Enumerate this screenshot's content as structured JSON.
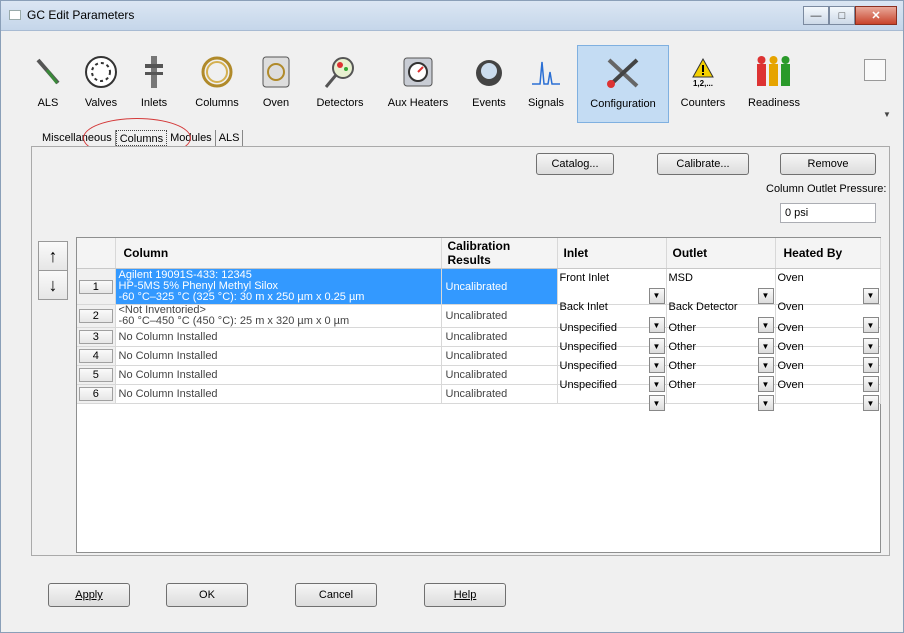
{
  "window": {
    "title": "GC Edit Parameters"
  },
  "toolbar": [
    {
      "label": "ALS",
      "icon": "syringe-icon"
    },
    {
      "label": "Valves",
      "icon": "valve-icon"
    },
    {
      "label": "Inlets",
      "icon": "inlet-icon"
    },
    {
      "label": "Columns",
      "icon": "column-icon"
    },
    {
      "label": "Oven",
      "icon": "oven-icon"
    },
    {
      "label": "Detectors",
      "icon": "detector-icon"
    },
    {
      "label": "Aux Heaters",
      "icon": "aux-heater-icon"
    },
    {
      "label": "Events",
      "icon": "events-icon"
    },
    {
      "label": "Signals",
      "icon": "signal-icon"
    },
    {
      "label": "Configuration",
      "icon": "configuration-icon",
      "active": true
    },
    {
      "label": "Counters",
      "icon": "counters-icon",
      "sublabel": "1,2,..."
    },
    {
      "label": "Readiness",
      "icon": "readiness-icon"
    }
  ],
  "subtabs": [
    "Miscellaneous",
    "Columns",
    "Modules",
    "ALS"
  ],
  "actions": {
    "catalog": "Catalog...",
    "calibrate": "Calibrate...",
    "remove": "Remove"
  },
  "outlet_pressure": {
    "label": "Column Outlet Pressure:",
    "value": "0 psi"
  },
  "grid": {
    "headers": [
      "Column",
      "Calibration Results",
      "Inlet",
      "Outlet",
      "Heated By"
    ],
    "rows": [
      {
        "num": "1",
        "column": [
          "Agilent 19091S-433: 12345",
          "HP-5MS  5% Phenyl Methyl Silox",
          "-60 °C–325 °C (325 °C): 30 m x 250 µm x 0.25 µm"
        ],
        "cal": "Uncalibrated",
        "inlet": "Front Inlet",
        "outlet": "MSD",
        "heated": "Oven"
      },
      {
        "num": "2",
        "column": [
          "<Not Inventoried>",
          "-60 °C–450 °C (450 °C): 25 m x 320 µm x 0 µm"
        ],
        "cal": "Uncalibrated",
        "inlet": "Back Inlet",
        "outlet": "Back Detector",
        "heated": "Oven"
      },
      {
        "num": "3",
        "column": [
          "No Column Installed"
        ],
        "cal": "Uncalibrated",
        "inlet": "Unspecified",
        "outlet": "Other",
        "heated": "Oven"
      },
      {
        "num": "4",
        "column": [
          "No Column Installed"
        ],
        "cal": "Uncalibrated",
        "inlet": "Unspecified",
        "outlet": "Other",
        "heated": "Oven"
      },
      {
        "num": "5",
        "column": [
          "No Column Installed"
        ],
        "cal": "Uncalibrated",
        "inlet": "Unspecified",
        "outlet": "Other",
        "heated": "Oven"
      },
      {
        "num": "6",
        "column": [
          "No Column Installed"
        ],
        "cal": "Uncalibrated",
        "inlet": "Unspecified",
        "outlet": "Other",
        "heated": "Oven"
      }
    ]
  },
  "footer": {
    "apply": "Apply",
    "ok": "OK",
    "cancel": "Cancel",
    "help": "Help"
  }
}
